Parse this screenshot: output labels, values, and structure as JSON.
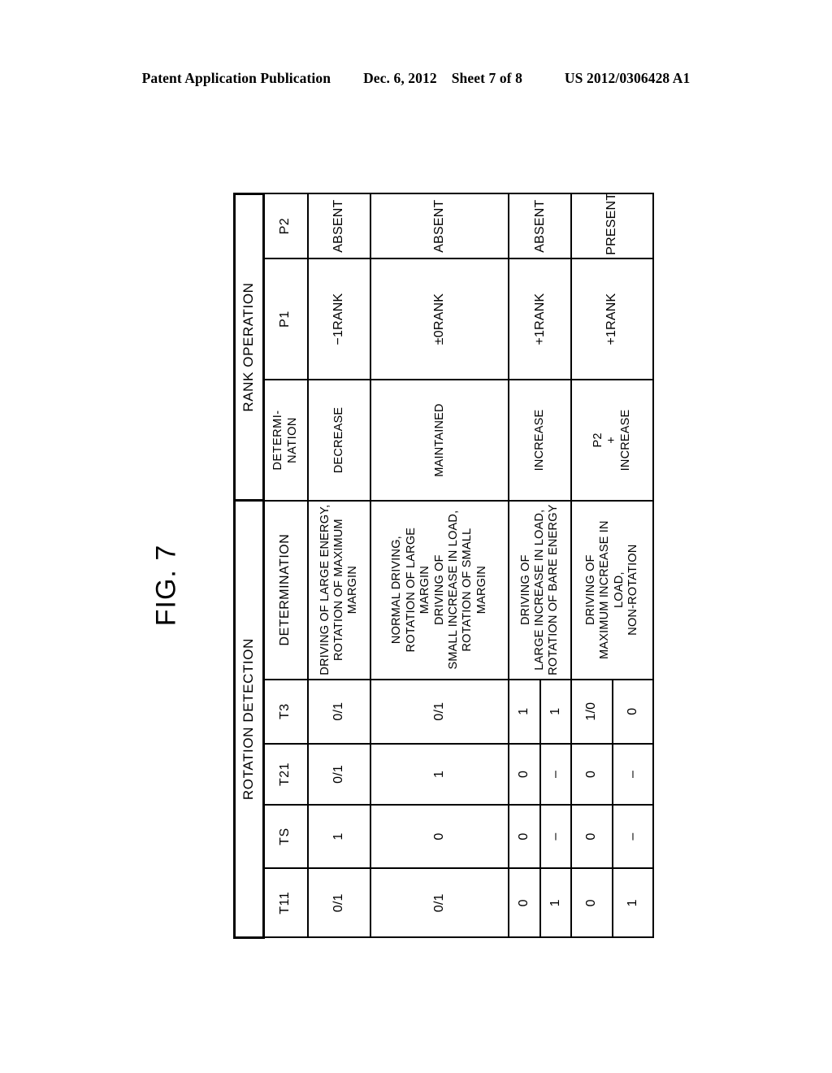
{
  "header": {
    "publication": "Patent Application Publication",
    "date": "Dec. 6, 2012",
    "sheet": "Sheet 7 of 8",
    "document_number": "US 2012/0306428 A1"
  },
  "figure": {
    "label": "FIG. 7"
  },
  "table": {
    "group_headers": {
      "rotation_detection": "ROTATION DETECTION",
      "rank_operation": "RANK OPERATION"
    },
    "column_headers": {
      "t11": "T11",
      "ts": "TS",
      "t21": "T21",
      "t3": "T3",
      "determination": "DETERMINATION",
      "rank_determination": "DETERMI-\nNATION",
      "p1": "P1",
      "p2": "P2"
    },
    "rows": [
      {
        "signals": [
          {
            "t11": "0/1",
            "ts": "1",
            "t21": "0/1",
            "t3": "0/1"
          }
        ],
        "determination": "DRIVING OF LARGE ENERGY,\nROTATION OF MAXIMUM MARGIN",
        "rank_determination": "DECREASE",
        "p1": "−1RANK",
        "p2": "ABSENT"
      },
      {
        "signals": [
          {
            "t11": "0/1",
            "ts": "0",
            "t21": "1",
            "t3": "0/1"
          }
        ],
        "determination": "NORMAL DRIVING,\nROTATION OF LARGE MARGIN\nDRIVING OF\nSMALL INCREASE IN LOAD,\nROTATION OF SMALL MARGIN",
        "rank_determination": "MAINTAINED",
        "p1": "±0RANK",
        "p2": "ABSENT"
      },
      {
        "signals": [
          {
            "t11": "0",
            "ts": "0",
            "t21": "0",
            "t3": "1"
          },
          {
            "t11": "1",
            "ts": "–",
            "t21": "–",
            "t3": "1"
          }
        ],
        "determination": "DRIVING OF\nLARGE INCREASE IN LOAD,\nROTATION OF BARE ENERGY",
        "rank_determination": "INCREASE",
        "p1": "+1RANK",
        "p2": "ABSENT"
      },
      {
        "signals": [
          {
            "t11": "0",
            "ts": "0",
            "t21": "0",
            "t3": "1/0"
          },
          {
            "t11": "1",
            "ts": "–",
            "t21": "–",
            "t3": "0"
          }
        ],
        "determination": "DRIVING OF\nMAXIMUM INCREASE IN LOAD,\nNON-ROTATION",
        "rank_determination": "P2\n+\nINCREASE",
        "p1": "+1RANK",
        "p2": "PRESENT"
      }
    ]
  }
}
